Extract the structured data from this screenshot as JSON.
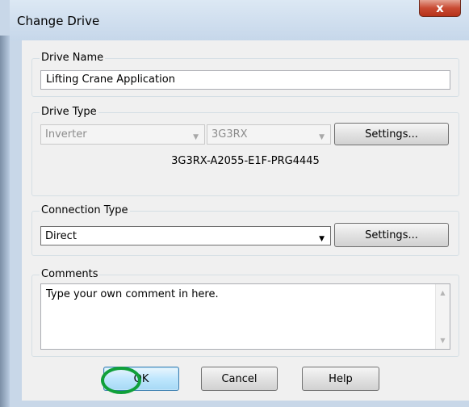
{
  "window": {
    "title": "Change Drive",
    "close_glyph": "x"
  },
  "drive_name": {
    "label": "Drive Name",
    "value": "Lifting Crane Application"
  },
  "drive_type": {
    "label": "Drive Type",
    "type_value": "Inverter",
    "model_value": "3G3RX",
    "settings_label": "Settings...",
    "model_code": "3G3RX-A2055-E1F-PRG4445",
    "arrow_glyph": "▼"
  },
  "connection_type": {
    "label": "Connection Type",
    "value": "Direct",
    "settings_label": "Settings...",
    "arrow_glyph": "▼"
  },
  "comments": {
    "label": "Comments",
    "text": "Type your own comment in here.",
    "scroll_up_glyph": "▲",
    "scroll_down_glyph": "▼"
  },
  "buttons": {
    "ok": "OK",
    "cancel": "Cancel",
    "help": "Help"
  },
  "colors": {
    "highlight_circle": "#10a03a",
    "default_button_border": "#3c7fb1"
  }
}
